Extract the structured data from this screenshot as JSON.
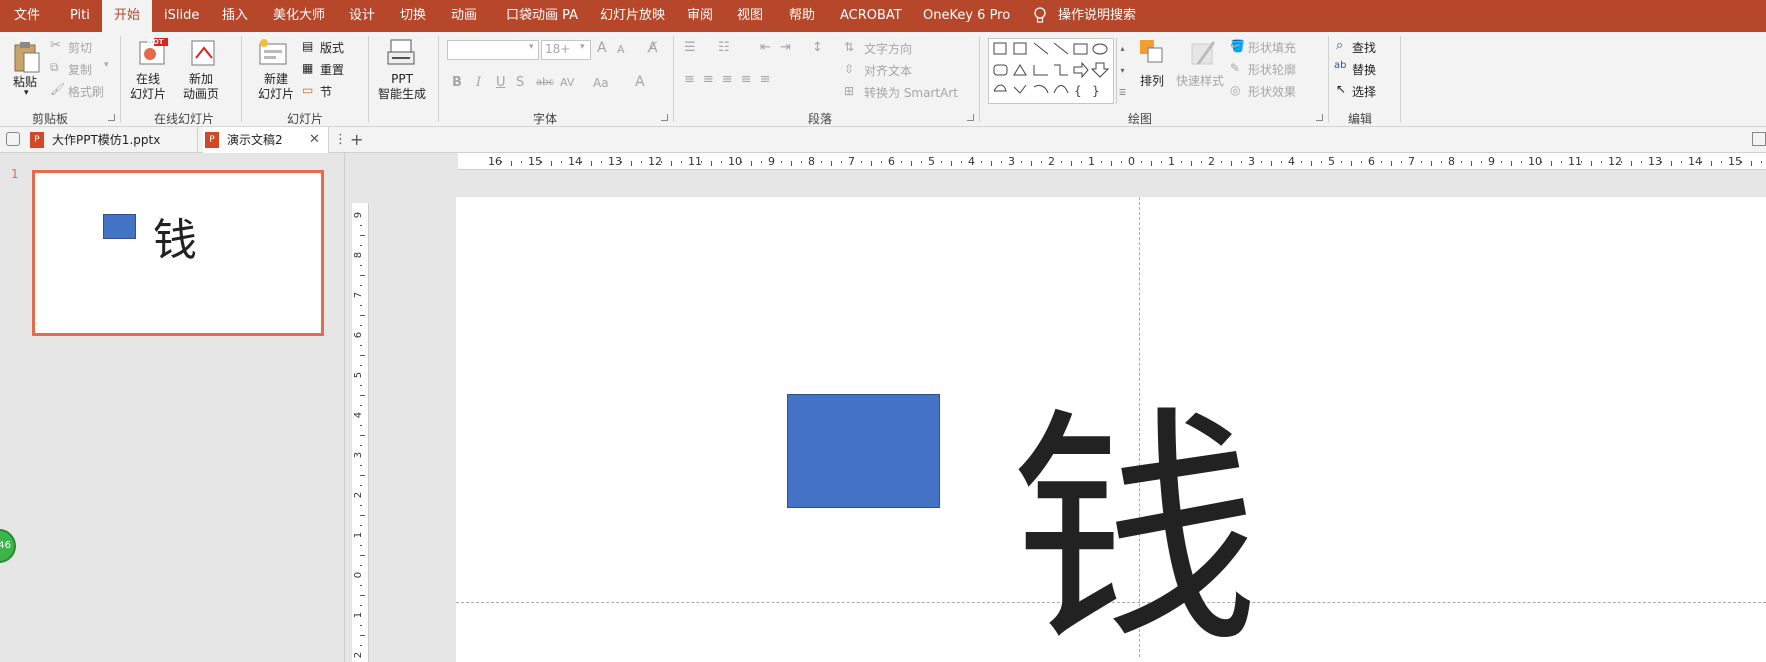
{
  "menubar": {
    "items": [
      "文件",
      "Piti",
      "开始",
      "iSlide",
      "插入",
      "美化大师",
      "设计",
      "切换",
      "动画",
      "口袋动画 PA",
      "幻灯片放映",
      "审阅",
      "视图",
      "帮助",
      "ACROBAT",
      "OneKey 6 Pro"
    ],
    "active": "开始",
    "tell_me": "操作说明搜索"
  },
  "ribbon": {
    "clipboard": {
      "paste": "粘贴",
      "cut": "剪切",
      "copy": "复制",
      "format_painter": "格式刷",
      "group": "剪贴板"
    },
    "online": {
      "online_slides": "在线\n幻灯片",
      "hot_badge": "HOT",
      "new_anim_page": "新加\n动画页",
      "group": "在线幻灯片"
    },
    "slides": {
      "new_slide": "新建\n幻灯片",
      "layout": "版式",
      "reset": "重置",
      "section": "节",
      "group": "幻灯片"
    },
    "ppt_ai": {
      "label": "PPT\n智能生成"
    },
    "font": {
      "font_size": "18+",
      "bold": "B",
      "italic": "I",
      "underline": "U",
      "shadow": "S",
      "strike": "abc",
      "spacing": "AV",
      "case": "Aa",
      "font_color": "A",
      "grow": "A",
      "shrink": "A",
      "group": "字体"
    },
    "paragraph": {
      "text_direction": "文字方向",
      "align_text": "对齐文本",
      "smartart": "转换为 SmartArt",
      "group": "段落"
    },
    "drawing": {
      "arrange": "排列",
      "quick_styles": "快速样式",
      "shape_fill": "形状填充",
      "shape_outline": "形状轮廓",
      "shape_effects": "形状效果",
      "group": "绘图"
    },
    "editing": {
      "find": "查找",
      "replace": "替换",
      "select": "选择",
      "group": "编辑"
    }
  },
  "tabs": [
    {
      "label": "大作PPT模仿1.pptx",
      "active": false
    },
    {
      "label": "演示文稿2",
      "active": true
    }
  ],
  "slide_panel": {
    "slide_number": "1",
    "thumb_text": "钱"
  },
  "slide": {
    "text": "钱",
    "rect_color": "#4472c4"
  },
  "badge": {
    "text": "46"
  },
  "rulers": {
    "horizontal": [
      "16",
      "15",
      "14",
      "13",
      "12",
      "11",
      "10",
      "9",
      "8",
      "7",
      "6",
      "5",
      "4",
      "3",
      "2",
      "1",
      "0",
      "1",
      "2",
      "3",
      "4",
      "5",
      "6",
      "7",
      "8",
      "9",
      "10",
      "11",
      "12",
      "13",
      "14",
      "15",
      "16"
    ],
    "vertical": [
      "9",
      "8",
      "7",
      "6",
      "5",
      "4",
      "3",
      "2",
      "1",
      "0",
      "1",
      "2"
    ]
  },
  "colors": {
    "accent": "#b7472a",
    "thumb_border": "#e46c4d"
  }
}
